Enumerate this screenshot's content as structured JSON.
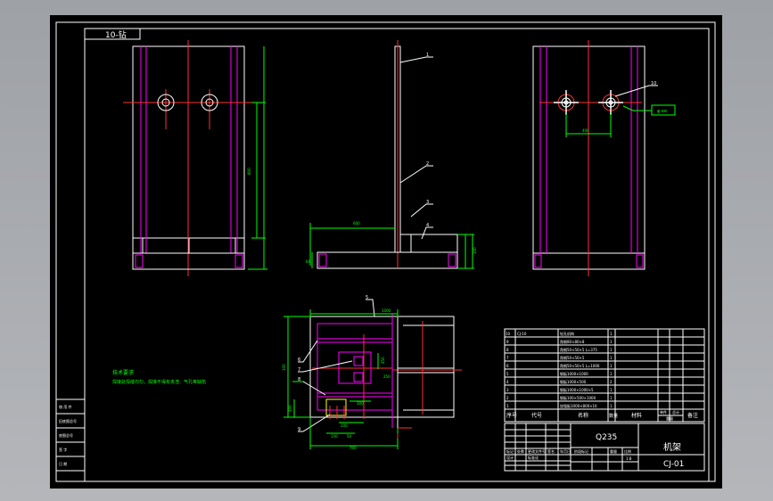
{
  "title_block_top": {
    "label": "10-钻"
  },
  "part_labels": [
    "1",
    "2",
    "3",
    "4",
    "5",
    "6",
    "7",
    "8",
    "9",
    "10"
  ],
  "dimensions": {
    "front_height": "800",
    "base_length": "600",
    "base_height": "60",
    "side_right": "100",
    "hole_spacing": "400",
    "note_tag": "φ.ee",
    "plan_width": "1000",
    "plan_left": "100",
    "plan_depth": "700",
    "plan_small_1": "100",
    "plan_small_2": "150",
    "plan_small_3": "50",
    "plan_small_4": "200",
    "plan_inner": "300",
    "plan_side": "450",
    "plan_side_2": "250"
  },
  "tech_notes": {
    "heading": "技术要求",
    "line1": "焊接处焊缝均匀，焊接不得有夹渣、气孔等缺陷"
  },
  "parts_list": {
    "rows": [
      {
        "no": "10",
        "code": "CJ-10",
        "name": "钻孔机构",
        "qty": "1"
      },
      {
        "no": "9",
        "code": "",
        "name": "角钢80×80×8",
        "qty": "1"
      },
      {
        "no": "8",
        "code": "",
        "name": "角钢50×50×5 L=375",
        "qty": "1"
      },
      {
        "no": "7",
        "code": "",
        "name": "角钢50×50×5",
        "qty": "1"
      },
      {
        "no": "6",
        "code": "",
        "name": "角钢50×50×5 L=1000",
        "qty": "1"
      },
      {
        "no": "5",
        "code": "",
        "name": "钢板1000×1000",
        "qty": "1"
      },
      {
        "no": "4",
        "code": "",
        "name": "钢板1000×500",
        "qty": "2"
      },
      {
        "no": "3",
        "code": "",
        "name": "钢板1000×1000×5",
        "qty": "1"
      },
      {
        "no": "2",
        "code": "",
        "name": "钢板100×500×1000",
        "qty": "1"
      },
      {
        "no": "1",
        "code": "",
        "name": "加强板1000×800×10",
        "qty": "1"
      }
    ],
    "headers": {
      "no": "序号",
      "code": "代号",
      "name": "名称",
      "qty": "数量",
      "material": "材料",
      "unit_weight": "单件",
      "total_weight": "总计",
      "weight": "重量",
      "remark": "备注"
    }
  },
  "title_block": {
    "material": "Q235",
    "drawing_name": "机架",
    "drawing_code": "CJ-01",
    "scale": "1:8",
    "labels": {
      "mark": "标记",
      "count": "处数",
      "zone": "分区",
      "change": "更改文件号",
      "sign": "签名",
      "date": "年月日",
      "design": "设计",
      "standard": "标准化",
      "stage": "阶段标记",
      "weight": "重量",
      "ratio": "比例"
    }
  },
  "left_strip": {
    "items": [
      "借 用 件",
      "旧底图总号",
      "底图总号",
      "签  字",
      "日  期"
    ]
  },
  "colors": {
    "border": "#ffffff",
    "contour": "#ffffff",
    "center": "#ff3030",
    "hidden": "#ff00ff",
    "dim": "#00ff00",
    "highlight": "#ffff00",
    "note": "#00ff00"
  }
}
